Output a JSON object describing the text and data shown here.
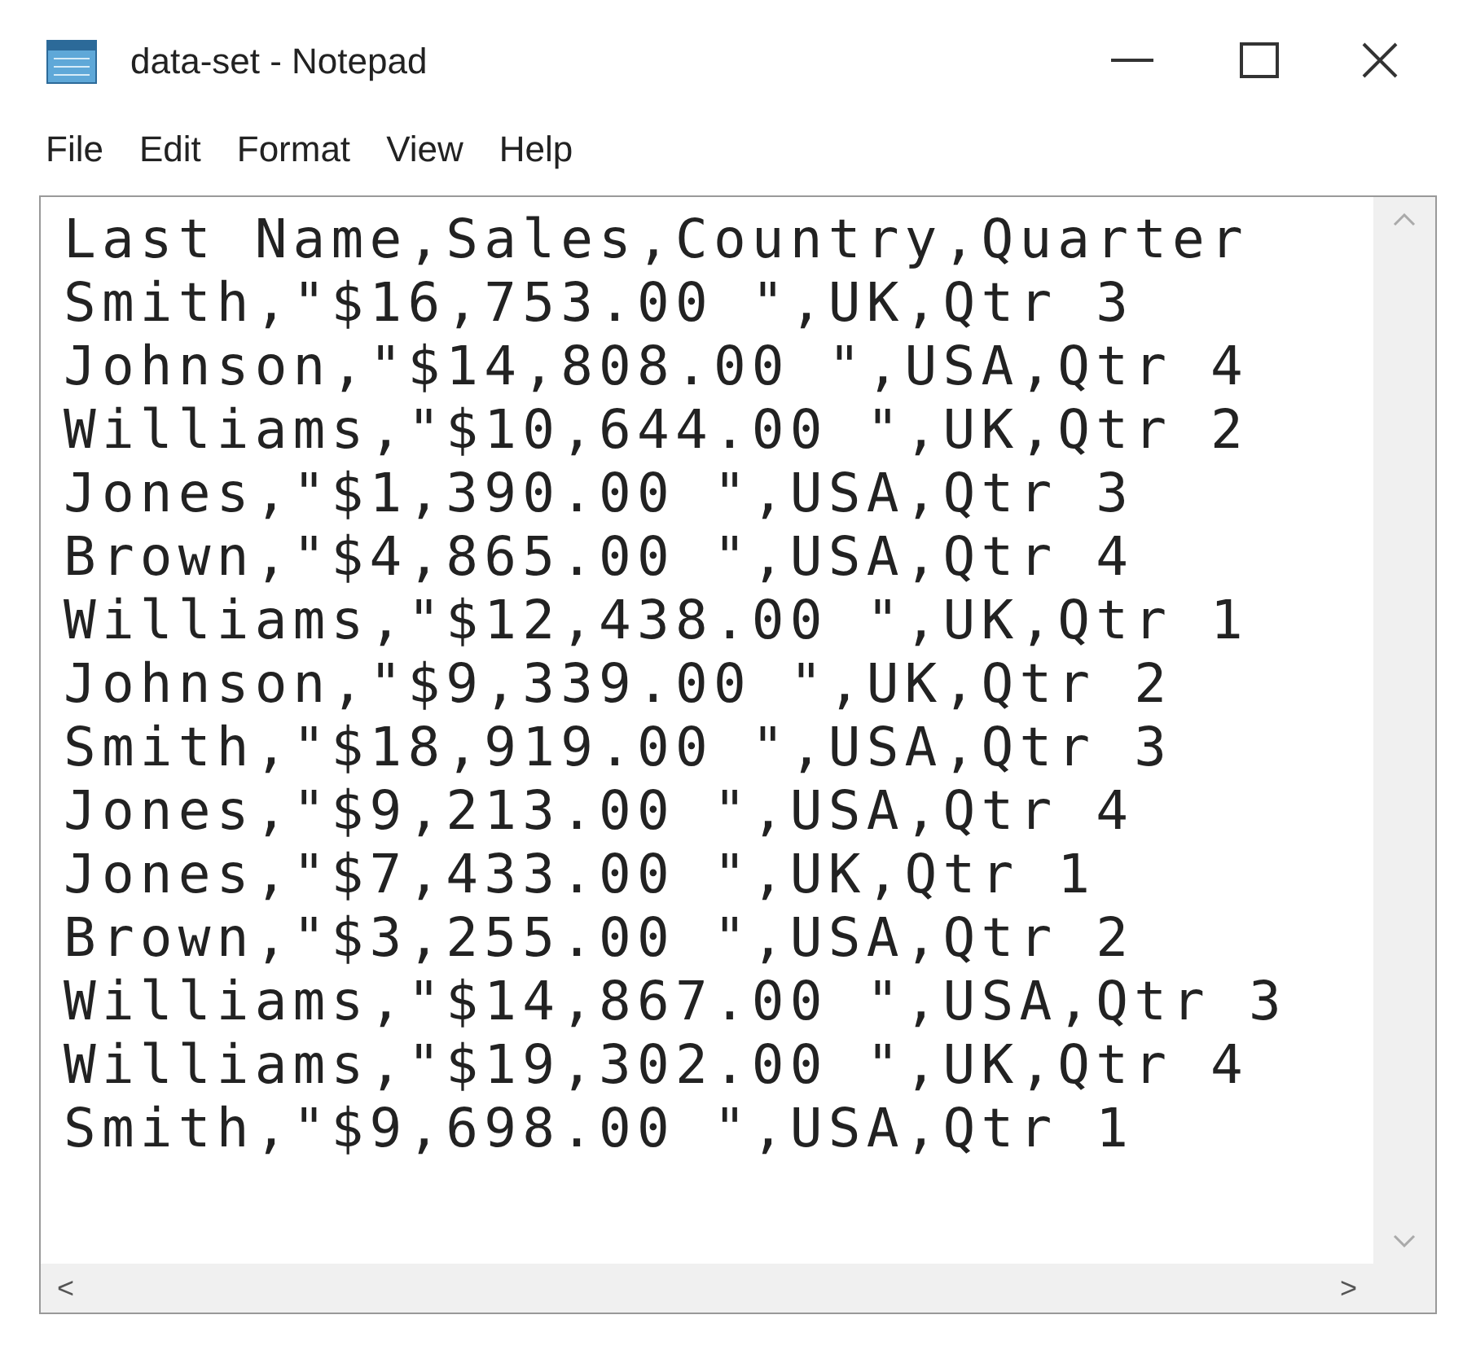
{
  "window": {
    "title": "data-set - Notepad"
  },
  "menu": [
    "File",
    "Edit",
    "Format",
    "View",
    "Help"
  ],
  "lines": [
    "Last Name,Sales,Country,Quarter",
    "Smith,\"$16,753.00 \",UK,Qtr 3",
    "Johnson,\"$14,808.00 \",USA,Qtr 4",
    "Williams,\"$10,644.00 \",UK,Qtr 2",
    "Jones,\"$1,390.00 \",USA,Qtr 3",
    "Brown,\"$4,865.00 \",USA,Qtr 4",
    "Williams,\"$12,438.00 \",UK,Qtr 1",
    "Johnson,\"$9,339.00 \",UK,Qtr 2",
    "Smith,\"$18,919.00 \",USA,Qtr 3",
    "Jones,\"$9,213.00 \",USA,Qtr 4",
    "Jones,\"$7,433.00 \",UK,Qtr 1",
    "Brown,\"$3,255.00 \",USA,Qtr 2",
    "Williams,\"$14,867.00 \",USA,Qtr 3",
    "Williams,\"$19,302.00 \",UK,Qtr 4",
    "Smith,\"$9,698.00 \",USA,Qtr 1"
  ],
  "scroll_left": "<",
  "scroll_right": ">"
}
